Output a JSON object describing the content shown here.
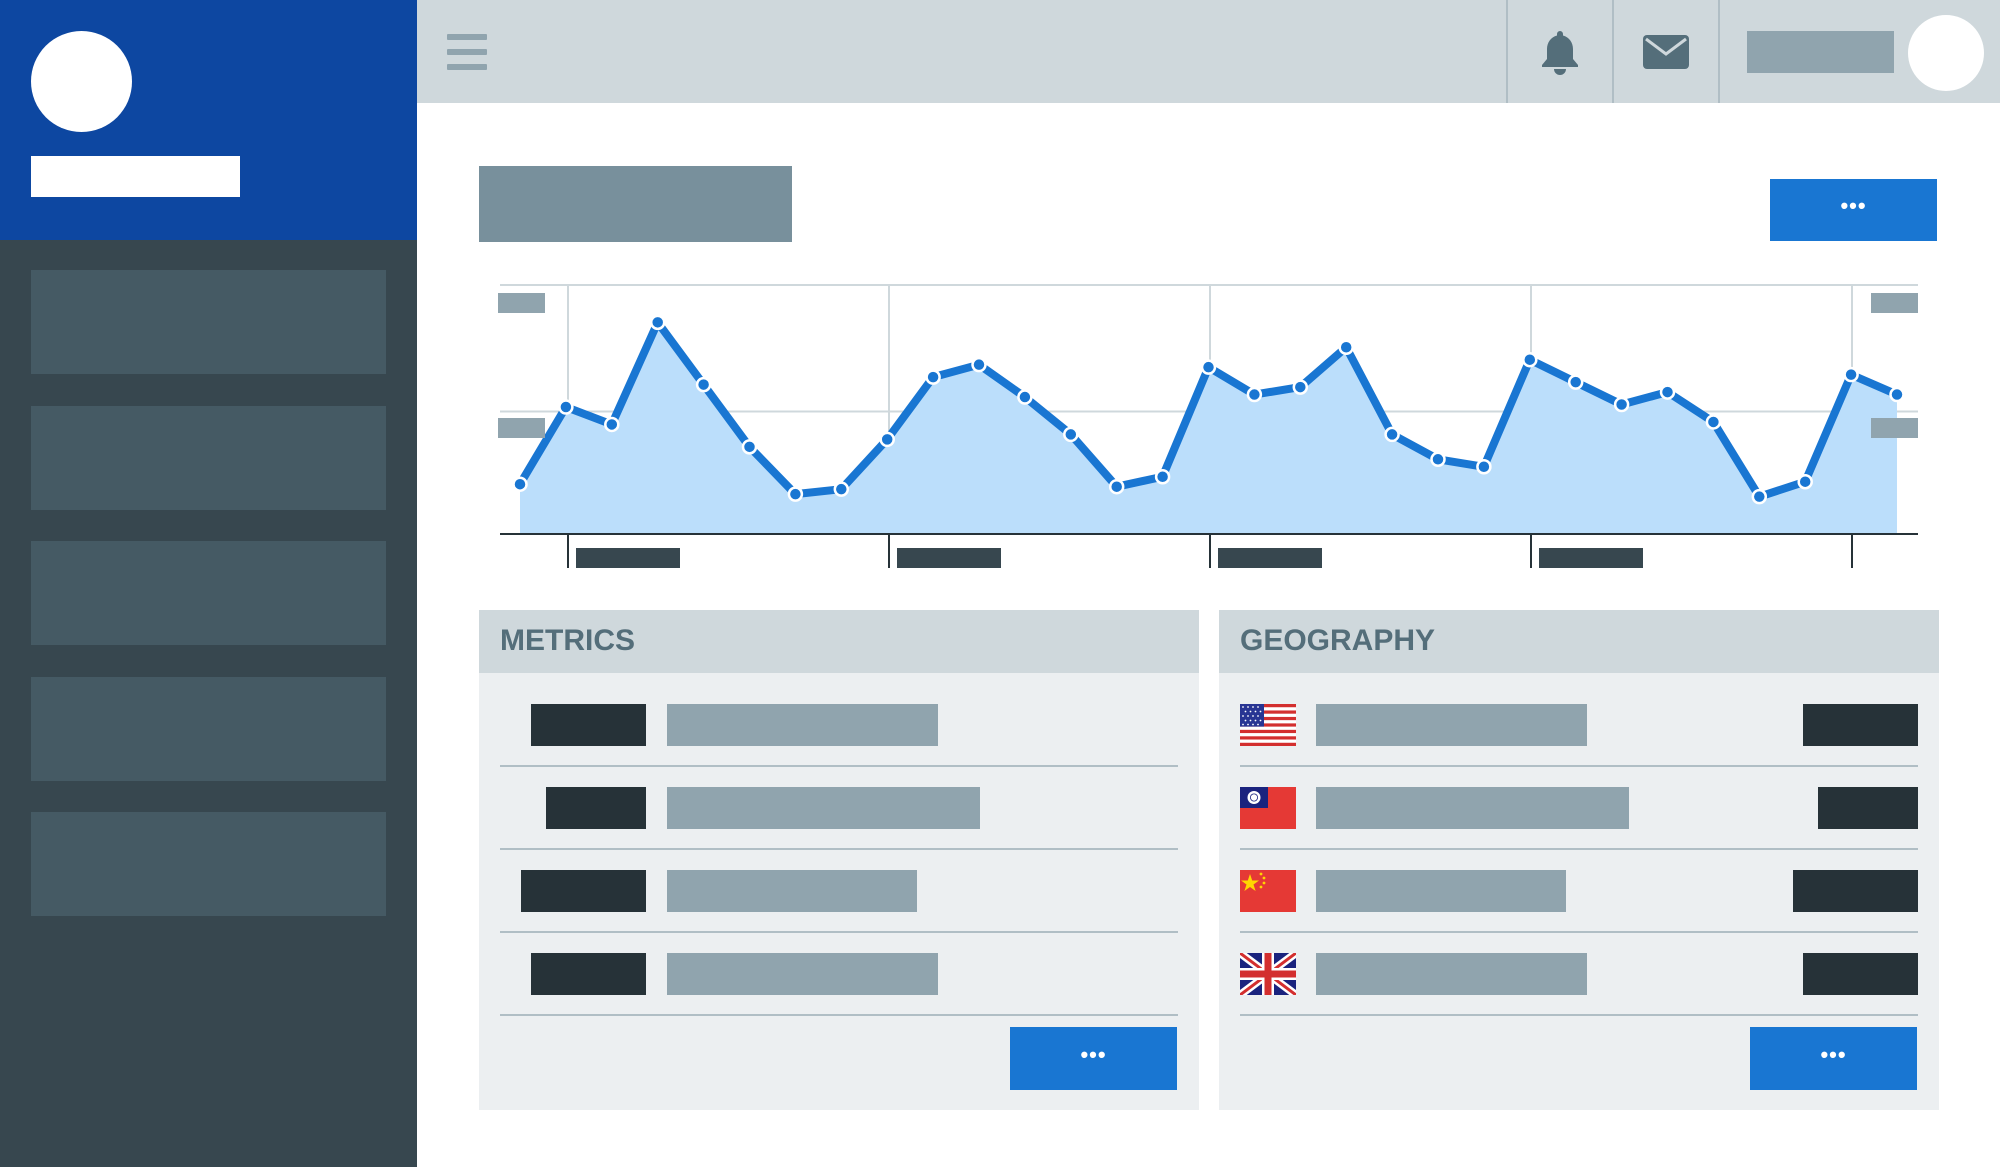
{
  "window": {
    "title": ""
  },
  "sidebar": {
    "items": [
      {
        "label": ""
      },
      {
        "label": ""
      },
      {
        "label": ""
      },
      {
        "label": ""
      },
      {
        "label": ""
      }
    ]
  },
  "topbar": {
    "icons": [
      "menu-icon",
      "bell-icon",
      "mail-icon"
    ]
  },
  "header": {
    "more_label": "•••"
  },
  "colors": {
    "accent": "#1976d2",
    "line": "#1976d2",
    "area": "#bbdefb",
    "sidebar": "#37474f",
    "sidebar_head": "#0d47a1"
  },
  "chart_data": {
    "type": "area",
    "title": "",
    "xlabel": "",
    "ylabel": "",
    "ylim": [
      0,
      100
    ],
    "grid": true,
    "x": [
      0,
      1,
      2,
      3,
      4,
      5,
      6,
      7,
      8,
      9,
      10,
      11,
      12,
      13,
      14,
      15,
      16,
      17,
      18,
      19,
      20,
      21,
      22,
      23,
      24,
      25,
      26,
      27,
      28,
      29,
      30
    ],
    "series": [
      {
        "values": [
          20,
          51,
          44,
          85,
          60,
          35,
          16,
          18,
          38,
          63,
          68,
          55,
          40,
          19,
          23,
          67,
          56,
          59,
          75,
          40,
          30,
          27,
          70,
          61,
          52,
          57,
          45,
          15,
          21,
          64,
          56
        ]
      }
    ]
  },
  "metrics": {
    "title": "METRICS",
    "more_label": "•••",
    "rows": [
      {
        "bar": 0.66
      },
      {
        "bar": 0.76
      },
      {
        "bar": 0.61
      },
      {
        "bar": 0.66
      }
    ]
  },
  "geography": {
    "title": "GEOGRAPHY",
    "more_label": "•••",
    "rows": [
      {
        "flag": "us-flag-icon",
        "bar": 0.66
      },
      {
        "flag": "taiwan-flag-icon",
        "bar": 0.76
      },
      {
        "flag": "china-flag-icon",
        "bar": 0.61
      },
      {
        "flag": "uk-flag-icon",
        "bar": 0.66
      }
    ]
  }
}
